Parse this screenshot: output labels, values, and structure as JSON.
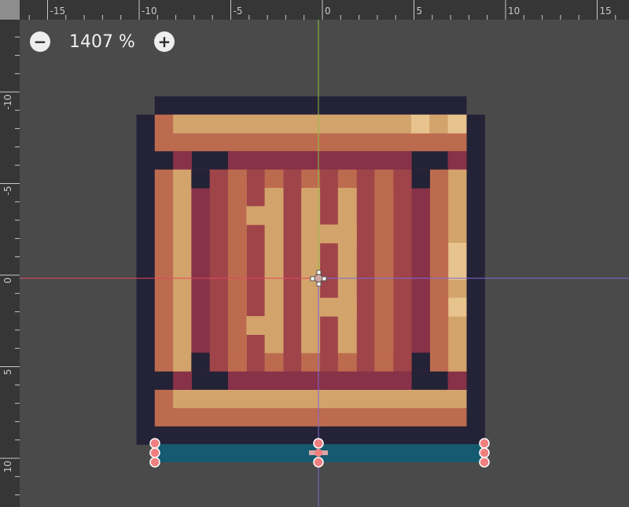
{
  "editor": {
    "zoom": {
      "level_label": "1407 %",
      "zoom_out_icon": "minus-circle-icon",
      "zoom_in_icon": "plus-circle-icon"
    },
    "ruler_ticks": {
      "horizontal": [
        "-15",
        "-10",
        "-5",
        "0",
        "5",
        "10",
        "15"
      ],
      "vertical": [
        "-10",
        "-5",
        "0",
        "5",
        "10"
      ]
    },
    "colors": {
      "background": "#4a4a4a",
      "ruler": "#363636",
      "x_axis": "#e0475f",
      "y_axis": "#8ec23f",
      "guide": "#7b6ad6",
      "collision_shape": "#155a70",
      "handle": "#f08080",
      "outline": "#242236",
      "wood_light": "#d3a36c",
      "wood_mid": "#bd6b4f",
      "wood_dark": "#9f4449",
      "wood_darkest": "#873248",
      "highlight": "#e7c38d"
    },
    "pivot_icon": "pivot-crosshair-icon",
    "sprite_name": "wooden-crate"
  }
}
